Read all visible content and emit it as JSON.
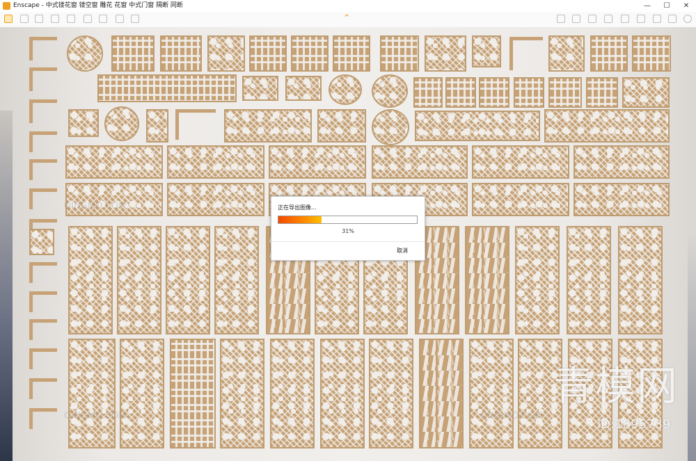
{
  "window": {
    "title": "Enscape - 中式镂花窗 镂空窗 雕花 花窗 中式门窗 隔断 同断",
    "minimize": "—",
    "maximize": "☐",
    "close": "✕"
  },
  "toolbar": {
    "collapse_arrow": "^"
  },
  "dialog": {
    "title": "正在导出图像...",
    "progress": 0.31,
    "percent_text": "31%",
    "cancel": "取消"
  },
  "watermarks": {
    "brand_cn": "青模网",
    "brand_en": "QINGMO.COM",
    "id_text": "ID:1895739"
  },
  "colors": {
    "wood": "#c6a276",
    "background": "#f1efec",
    "progress_start": "#f24a00",
    "progress_end": "#ffc000"
  }
}
